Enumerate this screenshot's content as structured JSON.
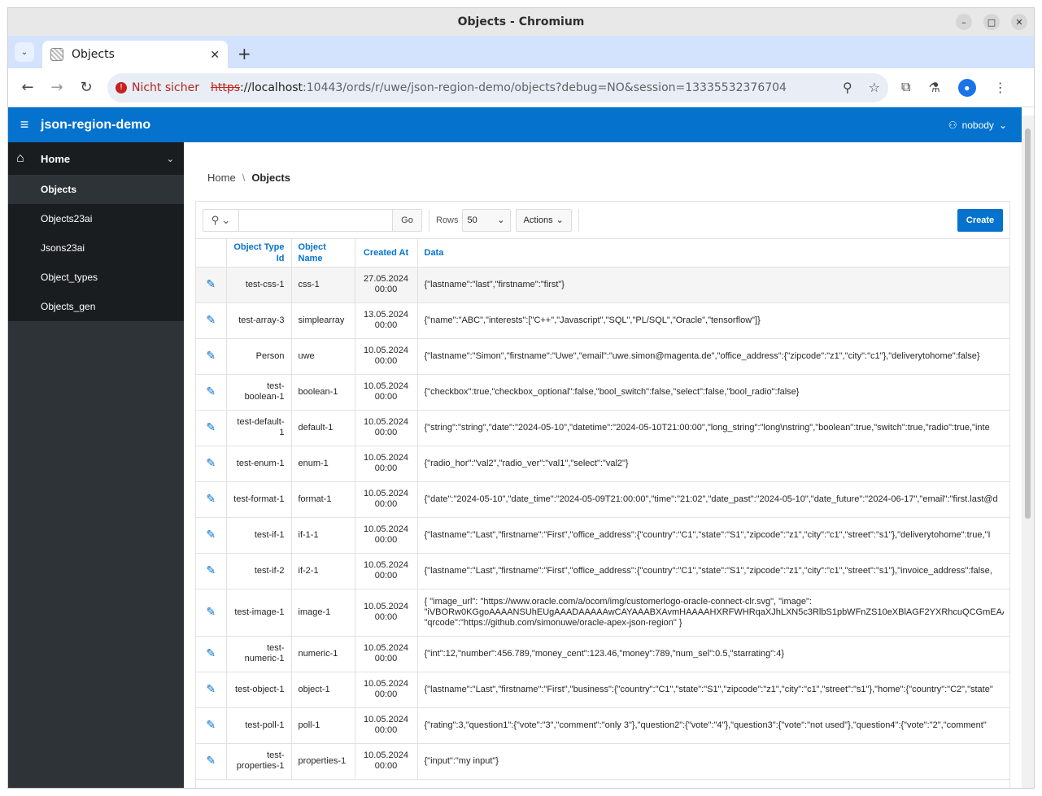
{
  "window": {
    "title": "Objects - Chromium"
  },
  "browser": {
    "tab_title": "Objects",
    "security_label": "Nicht sicher",
    "url_protocol": "https",
    "url_host": "://localhost",
    "url_rest": ":10443/ords/r/uwe/json-region-demo/objects?debug=NO&session=13335532376704"
  },
  "app": {
    "title": "json-region-demo",
    "user": "nobody"
  },
  "sidebar": {
    "top_label": "Home",
    "items": [
      {
        "label": "Objects"
      },
      {
        "label": "Objects23ai"
      },
      {
        "label": "Jsons23ai"
      },
      {
        "label": "Object_types"
      },
      {
        "label": "Objects_gen"
      }
    ]
  },
  "breadcrumb": {
    "home": "Home",
    "current": "Objects"
  },
  "report": {
    "go_label": "Go",
    "rows_label": "Rows",
    "rows_value": "50",
    "actions_label": "Actions",
    "create_label": "Create",
    "columns": {
      "type": "Object Type Id",
      "name": "Object Name",
      "created": "Created At",
      "data": "Data"
    },
    "rows": [
      {
        "type": "test-css-1",
        "name": "css-1",
        "created": "27.05.2024 00:00",
        "data": "{\"lastname\":\"last\",\"firstname\":\"first\"}"
      },
      {
        "type": "test-array-3",
        "name": "simplearray",
        "created": "13.05.2024 00:00",
        "data": "{\"name\":\"ABC\",\"interests\":[\"C++\",\"Javascript\",\"SQL\",\"PL/SQL\",\"Oracle\",\"tensorflow\"]}"
      },
      {
        "type": "Person",
        "name": "uwe",
        "created": "10.05.2024 00:00",
        "data": "{\"lastname\":\"Simon\",\"firstname\":\"Uwe\",\"email\":\"uwe.simon@magenta.de\",\"office_address\":{\"zipcode\":\"z1\",\"city\":\"c1\"},\"deliverytohome\":false}"
      },
      {
        "type": "test-boolean-1",
        "name": "boolean-1",
        "created": "10.05.2024 00:00",
        "data": "{\"checkbox\":true,\"checkbox_optional\":false,\"bool_switch\":false,\"select\":false,\"bool_radio\":false}"
      },
      {
        "type": "test-default-1",
        "name": "default-1",
        "created": "10.05.2024 00:00",
        "data": "{\"string\":\"string\",\"date\":\"2024-05-10\",\"datetime\":\"2024-05-10T21:00:00\",\"long_string\":\"long\\nstring\",\"boolean\":true,\"switch\":true,\"radio\":true,\"inte"
      },
      {
        "type": "test-enum-1",
        "name": "enum-1",
        "created": "10.05.2024 00:00",
        "data": "{\"radio_hor\":\"val2\",\"radio_ver\":\"val1\",\"select\":\"val2\"}"
      },
      {
        "type": "test-format-1",
        "name": "format-1",
        "created": "10.05.2024 00:00",
        "data": "{\"date\":\"2024-05-10\",\"date_time\":\"2024-05-09T21:00:00\",\"time\":\"21:02\",\"date_past\":\"2024-05-10\",\"date_future\":\"2024-06-17\",\"email\":\"first.last@d"
      },
      {
        "type": "test-if-1",
        "name": "if-1-1",
        "created": "10.05.2024 00:00",
        "data": "{\"lastname\":\"Last\",\"firstname\":\"First\",\"office_address\":{\"country\":\"C1\",\"state\":\"S1\",\"zipcode\":\"z1\",\"city\":\"c1\",\"street\":\"s1\"},\"deliverytohome\":true,\"I"
      },
      {
        "type": "test-if-2",
        "name": "if-2-1",
        "created": "10.05.2024 00:00",
        "data": "{\"lastname\":\"Last\",\"firstname\":\"First\",\"office_address\":{\"country\":\"C1\",\"state\":\"S1\",\"zipcode\":\"z1\",\"city\":\"c1\",\"street\":\"s1\"},\"invoice_address\":false,"
      },
      {
        "type": "test-image-1",
        "name": "image-1",
        "created": "10.05.2024 00:00",
        "data_lines": [
          "{ \"image_url\": \"https://www.oracle.com/a/ocom/img/customerlogo-oracle-connect-clr.svg\", \"image\":",
          "\"iVBORw0KGgoAAAANSUhEUgAAADAAAAAwCAYAAABXAvmHAAAAHXRFWHRqaXJhLXN5c3RlbS1pbWFnZS10eXBlAGF2YXRhcuQCGmEAABkRSU",
          "\"qrcode\":\"https://github.com/simonuwe/oracle-apex-json-region\" }"
        ]
      },
      {
        "type": "test-numeric-1",
        "name": "numeric-1",
        "created": "10.05.2024 00:00",
        "data": "{\"int\":12,\"number\":456.789,\"money_cent\":123.46,\"money\":789,\"num_sel\":0.5,\"starrating\":4}"
      },
      {
        "type": "test-object-1",
        "name": "object-1",
        "created": "10.05.2024 00:00",
        "data": "{\"lastname\":\"Last\",\"firstname\":\"First\",\"business\":{\"country\":\"C1\",\"state\":\"S1\",\"zipcode\":\"z1\",\"city\":\"c1\",\"street\":\"s1\"},\"home\":{\"country\":\"C2\",\"state\""
      },
      {
        "type": "test-poll-1",
        "name": "poll-1",
        "created": "10.05.2024 00:00",
        "data": "{\"rating\":3,\"question1\":{\"vote\":\"3\",\"comment\":\"only 3\"},\"question2\":{\"vote\":\"4\"},\"question3\":{\"vote\":\"not used\"},\"question4\":{\"vote\":\"2\",\"comment\""
      },
      {
        "type": "test-properties-1",
        "name": "properties-1",
        "created": "10.05.2024 00:00",
        "data": "{\"input\":\"my input\"}"
      }
    ]
  },
  "colors": {
    "header_blue": "#0572ce",
    "sidebar_dark": "#1a1d20",
    "sidebar_bg": "#2e3338",
    "insecure_red": "#c5221f"
  }
}
